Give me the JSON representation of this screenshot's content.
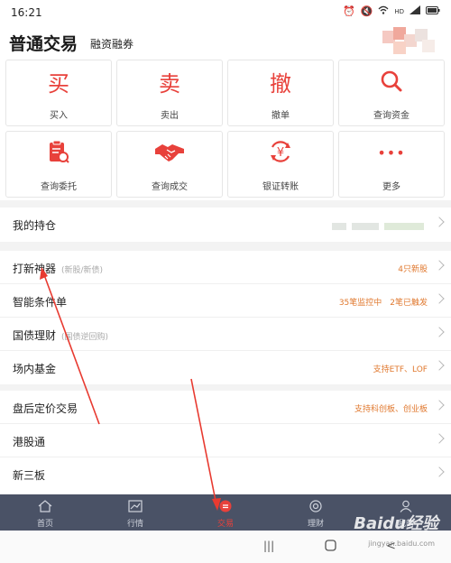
{
  "status_bar": {
    "time": "16:21",
    "icons": [
      "alarm-icon",
      "mute-icon",
      "wifi-icon",
      "hd-icon",
      "signal-icon",
      "battery-icon"
    ],
    "hd": "HD"
  },
  "header": {
    "title": "普通交易",
    "subtitle": "融资融券"
  },
  "grid": [
    {
      "label": "买入",
      "glyph": "买",
      "icon": "buy-icon"
    },
    {
      "label": "卖出",
      "glyph": "卖",
      "icon": "sell-icon"
    },
    {
      "label": "撤单",
      "glyph": "撤",
      "icon": "cancel-order-icon"
    },
    {
      "label": "查询资金",
      "glyph": "",
      "icon": "search-icon"
    },
    {
      "label": "查询委托",
      "glyph": "",
      "icon": "clipboard-search-icon"
    },
    {
      "label": "查询成交",
      "glyph": "",
      "icon": "handshake-icon"
    },
    {
      "label": "银证转账",
      "glyph": "¥",
      "icon": "yuan-transfer-icon"
    },
    {
      "label": "更多",
      "glyph": "•••",
      "icon": "more-icon"
    }
  ],
  "holdings": {
    "label": "我的持仓"
  },
  "menu_group1": [
    {
      "label": "打新神器",
      "sub": "(新股/新债)",
      "right": "4只新股"
    },
    {
      "label": "智能条件单",
      "sub": "",
      "right": "35笔监控中　2笔已触发"
    },
    {
      "label": "国债理财",
      "sub": "(国债逆回购)",
      "right": ""
    },
    {
      "label": "场内基金",
      "sub": "",
      "right": "支持ETF、LOF"
    }
  ],
  "menu_group2": [
    {
      "label": "盘后定价交易",
      "sub": "",
      "right": "支持科创板、创业板"
    },
    {
      "label": "港股通",
      "sub": "",
      "right": ""
    },
    {
      "label": "新三板",
      "sub": "",
      "right": ""
    }
  ],
  "tabs": [
    {
      "label": "首页",
      "icon": "home-icon"
    },
    {
      "label": "行情",
      "icon": "market-chart-icon"
    },
    {
      "label": "交易",
      "icon": "trade-icon",
      "active": true
    },
    {
      "label": "理财",
      "icon": "wealth-icon"
    },
    {
      "label": "我的",
      "icon": "profile-icon"
    }
  ],
  "nav": {
    "recent": "|||",
    "home": "○",
    "back": "<"
  },
  "watermark": {
    "brand": "Baidu经验",
    "url": "jingyan.baidu.com"
  },
  "colors": {
    "accent": "#e8413b",
    "orange": "#e0782e",
    "tabbar": "#4a5266"
  }
}
